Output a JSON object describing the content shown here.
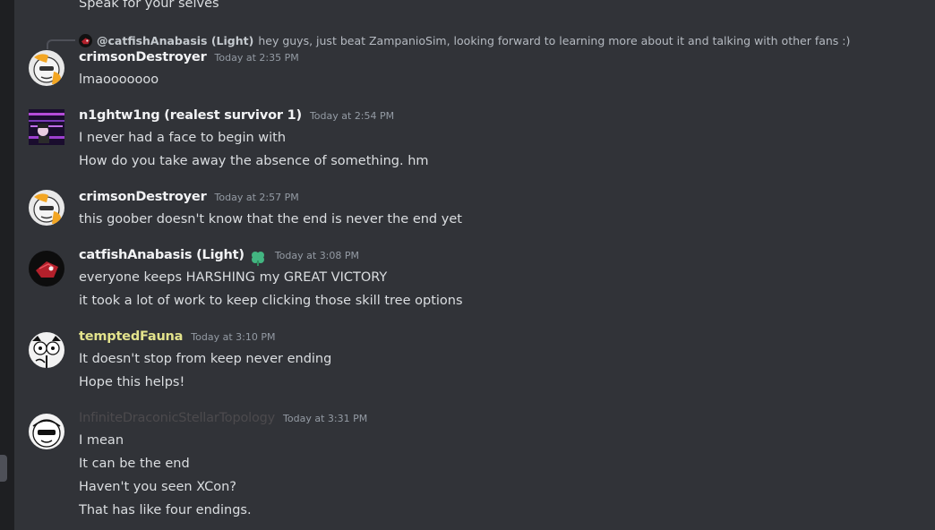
{
  "top_cut_message": "Speak for your selves",
  "reply": {
    "mention": "@catfishAnabasis (Light)",
    "text": "hey guys, just beat ZampanioSim, looking forward to learning more about it and talking with other fans :)"
  },
  "messages": [
    {
      "author": "crimsonDestroyer",
      "author_color": "#f2f3f5",
      "timestamp": "Today at 2:35 PM",
      "avatar_icon": "crimson-avatar-icon",
      "lines": [
        "lmaooooooo"
      ]
    },
    {
      "author": "n1ghtw1ng (realest survivor 1)",
      "author_color": "#f2f3f5",
      "timestamp": "Today at 2:54 PM",
      "avatar_icon": "nightwing-avatar-icon",
      "lines": [
        "I never had a face to begin with",
        "How do you take away the absence of something. hm"
      ]
    },
    {
      "author": "crimsonDestroyer",
      "author_color": "#f2f3f5",
      "timestamp": "Today at 2:57 PM",
      "avatar_icon": "crimson-avatar-icon",
      "lines": [
        "this goober doesn't know that the end is never the end yet"
      ]
    },
    {
      "author": "catfishAnabasis (Light)",
      "author_color": "#f2f3f5",
      "timestamp": "Today at 3:08 PM",
      "avatar_icon": "catfish-avatar-icon",
      "badge_icon": "clover-badge-icon",
      "lines": [
        "everyone keeps HARSHING my GREAT VICTORY",
        "it took a lot of work to keep clicking those skill tree options"
      ]
    },
    {
      "author": "temptedFauna",
      "author_color": "#e3e38c",
      "timestamp": "Today at 3:10 PM",
      "avatar_icon": "fauna-avatar-icon",
      "lines": [
        "It doesn't stop from keep never ending",
        "Hope this helps!"
      ]
    },
    {
      "author": "InfiniteDraconicStellarTopology",
      "author_color": "#4c4a4d",
      "timestamp": "Today at 3:31 PM",
      "avatar_icon": "infinite-avatar-icon",
      "lines": [
        "I mean",
        "It can be the end",
        "Haven't you seen XCon?",
        "That has like four endings."
      ]
    }
  ]
}
